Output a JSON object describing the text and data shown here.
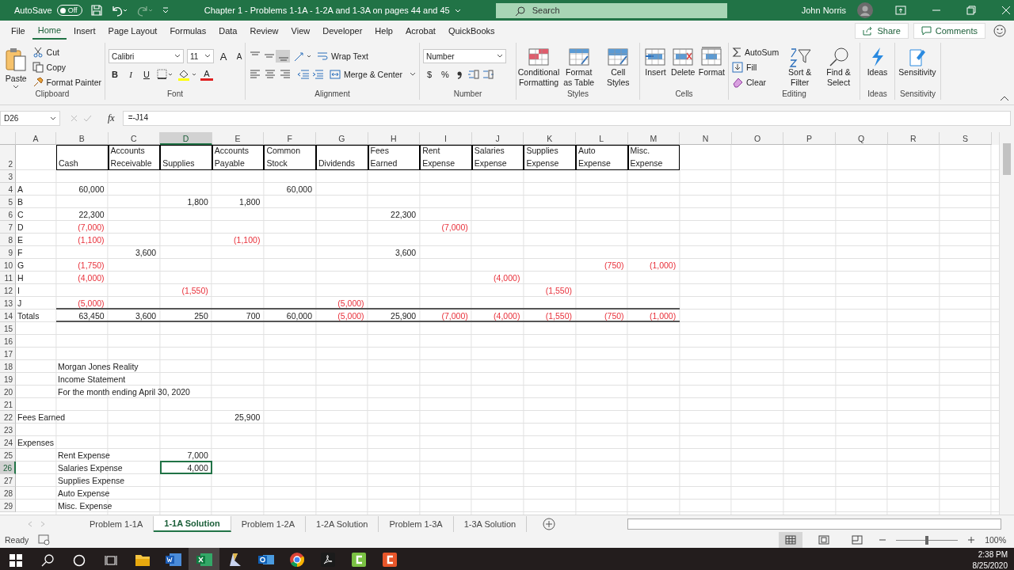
{
  "title_bar": {
    "autosave_label": "AutoSave",
    "autosave_state": "Off",
    "autosave_on": false,
    "title": "Chapter 1 - Problems 1-1A - 1-2A and 1-3A on pages 44 and 45",
    "search_placeholder": "Search",
    "user": "John Norris"
  },
  "ribbon": {
    "tabs": [
      {
        "label": "File",
        "selected": false
      },
      {
        "label": "Home",
        "selected": true
      },
      {
        "label": "Insert",
        "selected": false
      },
      {
        "label": "Page Layout",
        "selected": false
      },
      {
        "label": "Formulas",
        "selected": false
      },
      {
        "label": "Data",
        "selected": false
      },
      {
        "label": "Review",
        "selected": false
      },
      {
        "label": "View",
        "selected": false
      },
      {
        "label": "Developer",
        "selected": false
      },
      {
        "label": "Help",
        "selected": false
      },
      {
        "label": "Acrobat",
        "selected": false
      },
      {
        "label": "QuickBooks",
        "selected": false
      }
    ],
    "share": "Share",
    "comments": "Comments",
    "groups": {
      "clipboard": {
        "label": "Clipboard",
        "paste": "Paste",
        "cut": "Cut",
        "copy": "Copy",
        "format_painter": "Format Painter"
      },
      "font": {
        "label": "Font",
        "font_name": "Calibri",
        "font_size": "11",
        "grow": "A",
        "shrink": "A",
        "bold": "B",
        "italic": "I",
        "underline": "U",
        "font_color": "A"
      },
      "alignment": {
        "label": "Alignment",
        "wrap": "Wrap Text",
        "merge": "Merge & Center"
      },
      "number": {
        "label": "Number",
        "format": "Number",
        "currency": "$",
        "percent": "%"
      },
      "styles": {
        "label": "Styles",
        "conditional": "Conditional Formatting",
        "format_table": "Format as Table",
        "cell_styles": "Cell Styles"
      },
      "cells": {
        "label": "Cells",
        "insert": "Insert",
        "delete": "Delete",
        "format": "Format"
      },
      "editing": {
        "label": "Editing",
        "autosum": "AutoSum",
        "fill": "Fill",
        "clear": "Clear",
        "sort": "Sort & Filter",
        "find": "Find & Select"
      },
      "ideas": {
        "label": "Ideas",
        "button": "Ideas"
      },
      "sensitivity": {
        "label": "Sensitivity",
        "button": "Sensitivity"
      }
    }
  },
  "formula_bar": {
    "name_box": "D26",
    "fx": "fx",
    "formula": "=-J14"
  },
  "grid": {
    "columns": [
      {
        "label": "A",
        "selected": false
      },
      {
        "label": "B",
        "selected": false
      },
      {
        "label": "C",
        "selected": false
      },
      {
        "label": "D",
        "selected": true
      },
      {
        "label": "E",
        "selected": false
      },
      {
        "label": "F",
        "selected": false
      },
      {
        "label": "G",
        "selected": false
      },
      {
        "label": "H",
        "selected": false
      },
      {
        "label": "I",
        "selected": false
      },
      {
        "label": "J",
        "selected": false
      },
      {
        "label": "K",
        "selected": false
      },
      {
        "label": "L",
        "selected": false
      },
      {
        "label": "M",
        "selected": false
      },
      {
        "label": "N",
        "selected": false
      },
      {
        "label": "O",
        "selected": false
      },
      {
        "label": "P",
        "selected": false
      },
      {
        "label": "Q",
        "selected": false
      },
      {
        "label": "R",
        "selected": false
      },
      {
        "label": "S",
        "selected": false
      }
    ],
    "rows": [
      {
        "num": "2",
        "selected": false,
        "rule_below": false,
        "cells": [
          {
            "kind": "blank"
          },
          {
            "text": "Cash",
            "kind": "header"
          },
          {
            "text": "Accounts Receivable",
            "kind": "header"
          },
          {
            "text": "Supplies",
            "kind": "header"
          },
          {
            "text": "Accounts Payable",
            "kind": "header"
          },
          {
            "text": "Common Stock",
            "kind": "header"
          },
          {
            "text": "Dividends",
            "kind": "header"
          },
          {
            "text": "Fees Earned",
            "kind": "header"
          },
          {
            "text": "Rent Expense",
            "kind": "header"
          },
          {
            "text": "Salaries Expense",
            "kind": "header"
          },
          {
            "text": "Supplies Expense",
            "kind": "header"
          },
          {
            "text": "Auto Expense",
            "kind": "header"
          },
          {
            "text": "Misc. Expense",
            "kind": "header"
          }
        ]
      },
      {
        "num": "3",
        "selected": false,
        "rule_below": false,
        "cells": []
      },
      {
        "num": "4",
        "selected": false,
        "rule_below": false,
        "cells": [
          {
            "text": "A",
            "kind": "text"
          },
          {
            "text": "60,000",
            "kind": "num"
          },
          {
            "kind": "blank"
          },
          {
            "kind": "blank"
          },
          {
            "kind": "blank"
          },
          {
            "text": "60,000",
            "kind": "num"
          }
        ]
      },
      {
        "num": "5",
        "selected": false,
        "rule_below": false,
        "cells": [
          {
            "text": "B",
            "kind": "text"
          },
          {
            "kind": "blank"
          },
          {
            "kind": "blank"
          },
          {
            "text": "1,800",
            "kind": "num"
          },
          {
            "text": "1,800",
            "kind": "num"
          }
        ]
      },
      {
        "num": "6",
        "selected": false,
        "rule_below": false,
        "cells": [
          {
            "text": "C",
            "kind": "text"
          },
          {
            "text": "22,300",
            "kind": "num"
          },
          {
            "kind": "blank"
          },
          {
            "kind": "blank"
          },
          {
            "kind": "blank"
          },
          {
            "kind": "blank"
          },
          {
            "kind": "blank"
          },
          {
            "text": "22,300",
            "kind": "num"
          }
        ]
      },
      {
        "num": "7",
        "selected": false,
        "rule_below": false,
        "cells": [
          {
            "text": "D",
            "kind": "text"
          },
          {
            "text": "(7,000)",
            "kind": "neg"
          },
          {
            "kind": "blank"
          },
          {
            "kind": "blank"
          },
          {
            "kind": "blank"
          },
          {
            "kind": "blank"
          },
          {
            "kind": "blank"
          },
          {
            "kind": "blank"
          },
          {
            "text": "(7,000)",
            "kind": "neg"
          }
        ]
      },
      {
        "num": "8",
        "selected": false,
        "rule_below": false,
        "cells": [
          {
            "text": "E",
            "kind": "text"
          },
          {
            "text": "(1,100)",
            "kind": "neg"
          },
          {
            "kind": "blank"
          },
          {
            "kind": "blank"
          },
          {
            "text": "(1,100)",
            "kind": "neg"
          }
        ]
      },
      {
        "num": "9",
        "selected": false,
        "rule_below": false,
        "cells": [
          {
            "text": "F",
            "kind": "text"
          },
          {
            "kind": "blank"
          },
          {
            "text": "3,600",
            "kind": "num"
          },
          {
            "kind": "blank"
          },
          {
            "kind": "blank"
          },
          {
            "kind": "blank"
          },
          {
            "kind": "blank"
          },
          {
            "text": "3,600",
            "kind": "num"
          }
        ]
      },
      {
        "num": "10",
        "selected": false,
        "rule_below": false,
        "cells": [
          {
            "text": "G",
            "kind": "text"
          },
          {
            "text": "(1,750)",
            "kind": "neg"
          },
          {
            "kind": "blank"
          },
          {
            "kind": "blank"
          },
          {
            "kind": "blank"
          },
          {
            "kind": "blank"
          },
          {
            "kind": "blank"
          },
          {
            "kind": "blank"
          },
          {
            "kind": "blank"
          },
          {
            "kind": "blank"
          },
          {
            "kind": "blank"
          },
          {
            "text": "(750)",
            "kind": "neg"
          },
          {
            "text": "(1,000)",
            "kind": "neg"
          }
        ]
      },
      {
        "num": "11",
        "selected": false,
        "rule_below": false,
        "cells": [
          {
            "text": "H",
            "kind": "text"
          },
          {
            "text": "(4,000)",
            "kind": "neg"
          },
          {
            "kind": "blank"
          },
          {
            "kind": "blank"
          },
          {
            "kind": "blank"
          },
          {
            "kind": "blank"
          },
          {
            "kind": "blank"
          },
          {
            "kind": "blank"
          },
          {
            "kind": "blank"
          },
          {
            "text": "(4,000)",
            "kind": "neg"
          }
        ]
      },
      {
        "num": "12",
        "selected": false,
        "rule_below": false,
        "cells": [
          {
            "text": "I",
            "kind": "text"
          },
          {
            "kind": "blank"
          },
          {
            "kind": "blank"
          },
          {
            "text": "(1,550)",
            "kind": "neg"
          },
          {
            "kind": "blank"
          },
          {
            "kind": "blank"
          },
          {
            "kind": "blank"
          },
          {
            "kind": "blank"
          },
          {
            "kind": "blank"
          },
          {
            "kind": "blank"
          },
          {
            "text": "(1,550)",
            "kind": "neg"
          }
        ]
      },
      {
        "num": "13",
        "selected": false,
        "rule_below": true,
        "cells": [
          {
            "text": "J",
            "kind": "text"
          },
          {
            "text": "(5,000)",
            "kind": "neg"
          },
          {
            "kind": "blank"
          },
          {
            "kind": "blank"
          },
          {
            "kind": "blank"
          },
          {
            "kind": "blank"
          },
          {
            "text": "(5,000)",
            "kind": "neg"
          }
        ]
      },
      {
        "num": "14",
        "selected": false,
        "rule_below": true,
        "cells": [
          {
            "text": "Totals",
            "kind": "text"
          },
          {
            "text": "63,450",
            "kind": "num"
          },
          {
            "text": "3,600",
            "kind": "num"
          },
          {
            "text": "250",
            "kind": "num"
          },
          {
            "text": "700",
            "kind": "num"
          },
          {
            "text": "60,000",
            "kind": "num"
          },
          {
            "text": "(5,000)",
            "kind": "neg"
          },
          {
            "text": "25,900",
            "kind": "num"
          },
          {
            "text": "(7,000)",
            "kind": "neg"
          },
          {
            "text": "(4,000)",
            "kind": "neg"
          },
          {
            "text": "(1,550)",
            "kind": "neg"
          },
          {
            "text": "(750)",
            "kind": "neg"
          },
          {
            "text": "(1,000)",
            "kind": "neg"
          }
        ]
      },
      {
        "num": "15",
        "selected": false,
        "rule_below": false,
        "cells": []
      },
      {
        "num": "16",
        "selected": false,
        "rule_below": false,
        "cells": []
      },
      {
        "num": "17",
        "selected": false,
        "rule_below": false,
        "cells": []
      },
      {
        "num": "18",
        "selected": false,
        "rule_below": false,
        "cells": [
          {
            "kind": "blank"
          },
          {
            "text": "Morgan Jones Reality",
            "kind": "text"
          }
        ]
      },
      {
        "num": "19",
        "selected": false,
        "rule_below": false,
        "cells": [
          {
            "kind": "blank"
          },
          {
            "text": "Income Statement",
            "kind": "text"
          }
        ]
      },
      {
        "num": "20",
        "selected": false,
        "rule_below": false,
        "cells": [
          {
            "kind": "blank"
          },
          {
            "text": "For the month ending April 30, 2020",
            "kind": "text"
          }
        ]
      },
      {
        "num": "21",
        "selected": false,
        "rule_below": false,
        "cells": []
      },
      {
        "num": "22",
        "selected": false,
        "rule_below": false,
        "cells": [
          {
            "text": "Fees Earned",
            "kind": "text"
          },
          {
            "kind": "blank"
          },
          {
            "kind": "blank"
          },
          {
            "kind": "blank"
          },
          {
            "text": "25,900",
            "kind": "num"
          }
        ]
      },
      {
        "num": "23",
        "selected": false,
        "rule_below": false,
        "cells": []
      },
      {
        "num": "24",
        "selected": false,
        "rule_below": false,
        "cells": [
          {
            "text": "Expenses",
            "kind": "text"
          }
        ]
      },
      {
        "num": "25",
        "selected": false,
        "rule_below": false,
        "cells": [
          {
            "kind": "blank"
          },
          {
            "text": "Rent Expense",
            "kind": "text"
          },
          {
            "kind": "blank"
          },
          {
            "text": "7,000",
            "kind": "num"
          }
        ]
      },
      {
        "num": "26",
        "selected": true,
        "rule_below": false,
        "cells": [
          {
            "kind": "blank"
          },
          {
            "text": "Salaries Expense",
            "kind": "text"
          },
          {
            "kind": "blank"
          },
          {
            "text": "4,000",
            "kind": "num"
          }
        ]
      },
      {
        "num": "27",
        "selected": false,
        "rule_below": false,
        "cells": [
          {
            "kind": "blank"
          },
          {
            "text": "Supplies Expense",
            "kind": "text"
          }
        ]
      },
      {
        "num": "28",
        "selected": false,
        "rule_below": false,
        "cells": [
          {
            "kind": "blank"
          },
          {
            "text": "Auto Expense",
            "kind": "text"
          }
        ]
      },
      {
        "num": "29",
        "selected": false,
        "rule_below": false,
        "cells": [
          {
            "kind": "blank"
          },
          {
            "text": "Misc. Expense",
            "kind": "text"
          }
        ]
      }
    ]
  },
  "sheet_tabs": [
    {
      "label": "Problem 1-1A",
      "selected": false
    },
    {
      "label": "1-1A Solution",
      "selected": true
    },
    {
      "label": "Problem 1-2A",
      "selected": false
    },
    {
      "label": "1-2A Solution",
      "selected": false
    },
    {
      "label": "Problem 1-3A",
      "selected": false
    },
    {
      "label": "1-3A Solution",
      "selected": false
    }
  ],
  "status_bar": {
    "status": "Ready",
    "views": [
      {
        "kind": "normal",
        "selected": true
      },
      {
        "kind": "page-layout",
        "selected": false
      },
      {
        "kind": "page-break",
        "selected": false
      }
    ],
    "zoom": {
      "level": 0.5,
      "reading": "100%"
    }
  },
  "taskbar": {
    "apps": [
      {
        "kind": "folder",
        "active": false
      },
      {
        "kind": "document",
        "active": false
      },
      {
        "kind": "spreadsheet",
        "active": true
      },
      {
        "kind": "pen",
        "active": false
      },
      {
        "kind": "mail",
        "active": false
      },
      {
        "kind": "browser",
        "active": false
      },
      {
        "kind": "pdf",
        "active": false
      },
      {
        "kind": "recorder",
        "active": false
      },
      {
        "kind": "editor",
        "active": false
      }
    ],
    "time": "2:38 PM",
    "date": "8/25/2020"
  }
}
